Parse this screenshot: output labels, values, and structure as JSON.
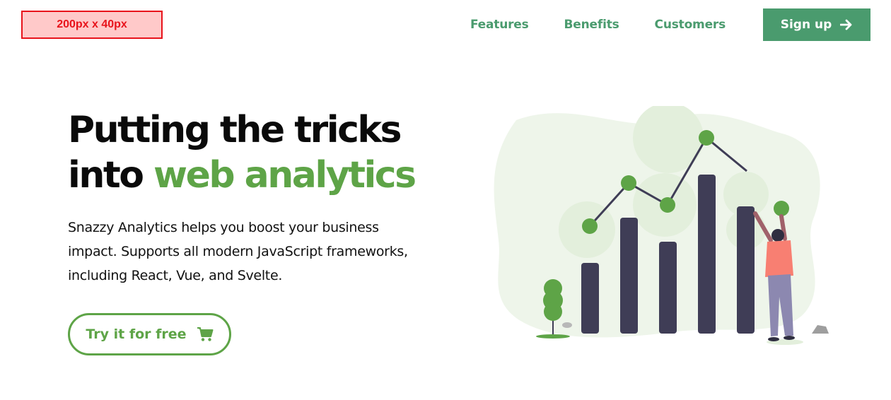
{
  "header": {
    "logo_placeholder": "200px x 40px",
    "nav": {
      "features": "Features",
      "benefits": "Benefits",
      "customers": "Customers"
    },
    "signup_label": "Sign up",
    "signup_icon": "arrow-right-icon"
  },
  "hero": {
    "title_line1": "Putting the tricks",
    "title_line2_plain": "into ",
    "title_line2_accent": "web analytics",
    "description": "Snazzy Analytics helps you boost your business impact. Supports all modern JavaScript frameworks, including React, Vue, and Svelte.",
    "cta_label": "Try it for free",
    "cta_icon": "shopping-cart-icon"
  },
  "illustration": {
    "description": "analytics bar chart illustration with person",
    "icon": "chart-illustration"
  },
  "colors": {
    "brand_green": "#4a9b6e",
    "accent_green": "#5ea447",
    "placeholder_red": "#e8131b",
    "bar_dark": "#3f3d56",
    "shirt": "#f87f72"
  }
}
